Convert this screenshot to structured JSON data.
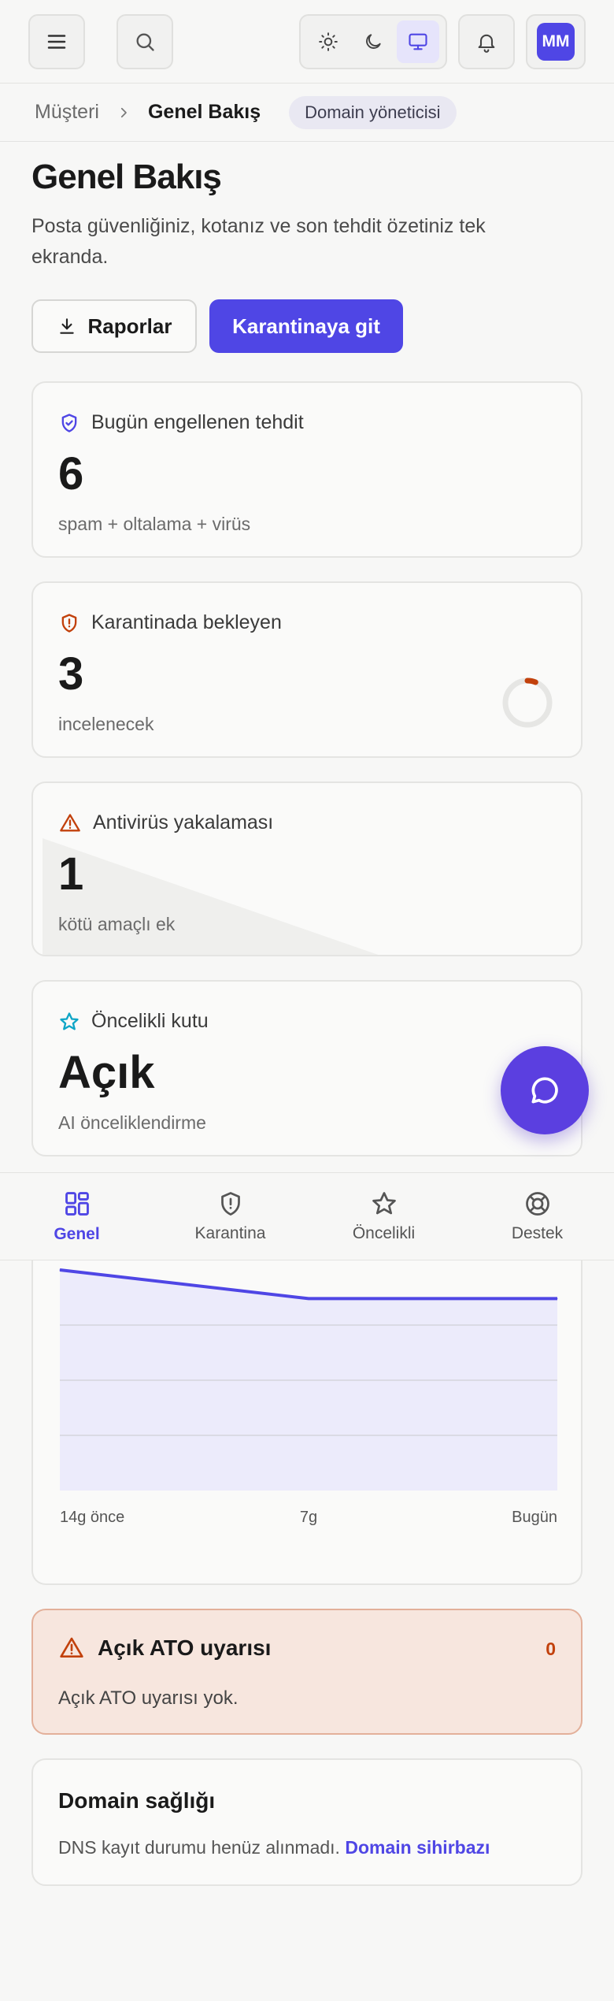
{
  "header": {
    "menu_icon": "hamburger-icon",
    "search_icon": "search-icon",
    "theme_options": [
      "sun-icon",
      "moon-icon",
      "monitor-icon"
    ],
    "active_theme": "monitor-icon",
    "notification_icon": "bell-icon",
    "avatar_initials": "MM"
  },
  "breadcrumb": {
    "parent": "Müşteri",
    "current": "Genel Bakış",
    "role_badge": "Domain yöneticisi"
  },
  "page": {
    "title": "Genel Bakış",
    "subtitle": "Posta güvenliğiniz, kotanız ve son tehdit özetiniz tek ekranda.",
    "reports_button": "Raporlar",
    "quarantine_button": "Karantinaya git"
  },
  "stats": [
    {
      "icon": "shield-check-icon",
      "label": "Bugün engellenen tehdit",
      "value": "6",
      "desc": "spam + oltalama + virüs",
      "color": "#4f46e5"
    },
    {
      "icon": "shield-alert-icon",
      "label": "Karantinada bekleyen",
      "value": "3",
      "desc": "incelenecek",
      "color": "#c2410c",
      "ring_progress": 0.06
    },
    {
      "icon": "warning-icon",
      "label": "Antivirüs yakalaması",
      "value": "1",
      "desc": "kötü amaçlı ek",
      "color": "#c2410c"
    },
    {
      "icon": "star-icon",
      "label": "Öncelikli kutu",
      "value": "Açık",
      "desc": "AI önceliklendirme",
      "color": "#0ea5c6"
    }
  ],
  "chat_fab_icon": "chat-bubble-icon",
  "bottom_nav": [
    {
      "label": "Genel",
      "icon": "grid-icon",
      "active": true
    },
    {
      "label": "Karantina",
      "icon": "shield-alert-icon",
      "active": false
    },
    {
      "label": "Öncelikli",
      "icon": "star-icon",
      "active": false
    },
    {
      "label": "Destek",
      "icon": "lifebuoy-icon",
      "active": false
    }
  ],
  "chart_data": {
    "type": "area",
    "x": [
      "14g önce",
      "7g",
      "Bugün"
    ],
    "tick_labels": [
      "14g önce",
      "7g",
      "Bugün"
    ],
    "series": [
      {
        "values": [
          100,
          87,
          87
        ]
      }
    ],
    "ylim": [
      0,
      100
    ],
    "grid": true,
    "color": "#4f46e5",
    "fill": "#ecebfb"
  },
  "ato": {
    "title": "Açık ATO uyarısı",
    "count": "0",
    "message": "Açık ATO uyarısı yok."
  },
  "domain_health": {
    "title": "Domain sağlığı",
    "message": "DNS kayıt durumu henüz alınmadı.",
    "link": "Domain sihirbazı"
  }
}
